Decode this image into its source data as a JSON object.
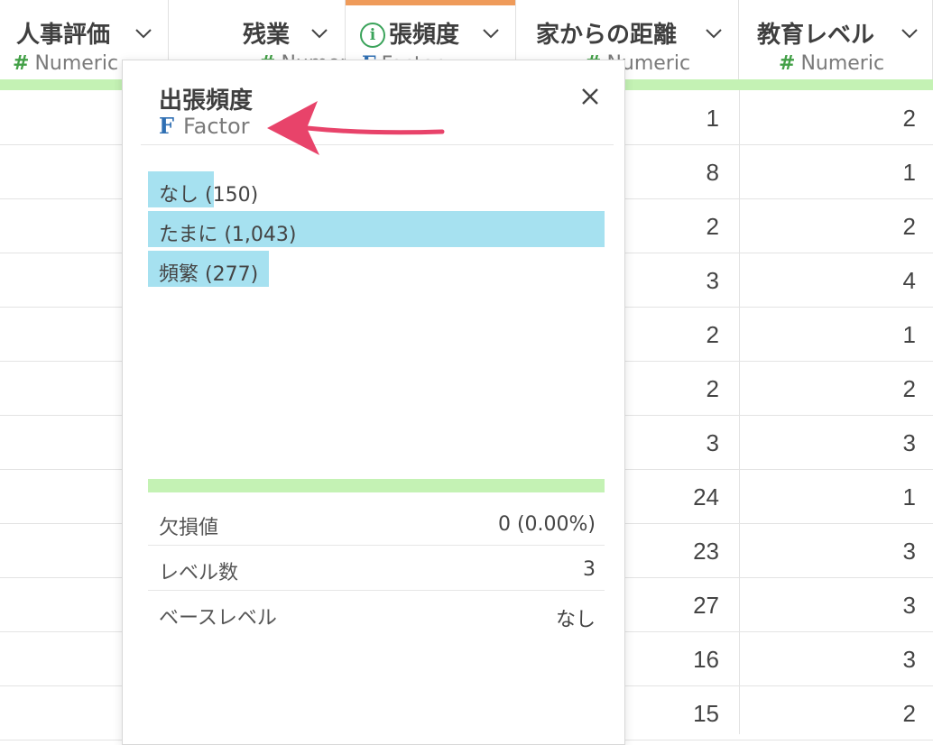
{
  "columns": [
    {
      "title": "人事評価",
      "type": "Numeric",
      "type_icon": "numeric-hash-icon"
    },
    {
      "title": "残業",
      "type": "Numeric",
      "type_icon": "numeric-hash-icon"
    },
    {
      "title": "張頻度",
      "type": "Factor",
      "type_icon": "factor-f-icon",
      "info": "i",
      "accent": "#ef9b5a"
    },
    {
      "title": "家からの距離",
      "type": "Numeric",
      "type_icon": "numeric-hash-icon"
    },
    {
      "title": "教育レベル",
      "type": "Numeric",
      "type_icon": "numeric-hash-icon"
    }
  ],
  "rows": {
    "distance": [
      "1",
      "8",
      "2",
      "3",
      "2",
      "2",
      "3",
      "24",
      "23",
      "27",
      "16",
      "15"
    ],
    "education": [
      "2",
      "1",
      "2",
      "4",
      "1",
      "2",
      "3",
      "1",
      "3",
      "3",
      "3",
      "2"
    ]
  },
  "popup": {
    "title": "出張頻度",
    "type_icon_label": "F",
    "type": "Factor",
    "levels": [
      {
        "label": "なし (150)",
        "count": 150
      },
      {
        "label": "たまに (1,043)",
        "count": 1043
      },
      {
        "label": "頻繁 (277)",
        "count": 277
      }
    ],
    "stats": [
      {
        "key": "欠損値",
        "value": "0 (0.00%)"
      },
      {
        "key": "レベル数",
        "value": "3"
      },
      {
        "key": "ベースレベル",
        "value": "なし"
      }
    ]
  },
  "colors": {
    "bar": "#a6e1f0",
    "missing_bar": "#c4f2b4",
    "annotation_arrow": "#e8436a"
  }
}
